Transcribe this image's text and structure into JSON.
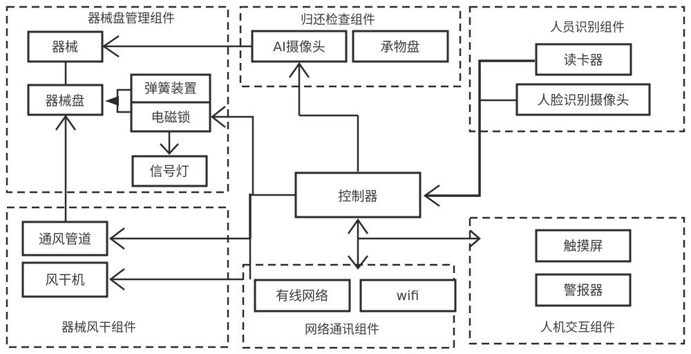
{
  "groups": {
    "tray_management": {
      "label": "器械盘管理组件"
    },
    "return_check": {
      "label": "归还检查组件"
    },
    "personnel_id": {
      "label": "人员识别组件"
    },
    "air_dry": {
      "label": "器械风干组件"
    },
    "network": {
      "label": "网络通讯组件"
    },
    "hmi": {
      "label": "人机交互组件"
    }
  },
  "nodes": {
    "instrument": "器械",
    "instrument_tray": "器械盘",
    "spring_device": "弹簧装置",
    "electromagnetic_lock": "电磁锁",
    "signal_light": "信号灯",
    "ai_camera": "AI摄像头",
    "carrier_tray": "承物盘",
    "card_reader": "读卡器",
    "face_camera": "人脸识别摄像头",
    "controller": "控制器",
    "vent_duct": "通风管道",
    "air_dryer": "风干机",
    "wired_network": "有线网络",
    "wifi": "wifi",
    "touchscreen": "触摸屏",
    "alarm": "警报器"
  },
  "edges": [
    {
      "from": "ai_camera",
      "to": "instrument"
    },
    {
      "from": "controller",
      "to": "ai_camera"
    },
    {
      "from": "controller",
      "to": "electromagnetic_lock"
    },
    {
      "from": "spring_device",
      "to": "instrument_tray"
    },
    {
      "from": "electromagnetic_lock",
      "to": "instrument_tray"
    },
    {
      "from": "electromagnetic_lock",
      "to": "signal_light"
    },
    {
      "from": "vent_duct",
      "to": "instrument_tray"
    },
    {
      "from": "controller",
      "to": "vent_duct"
    },
    {
      "from": "controller",
      "to": "air_dryer"
    },
    {
      "from": "card_reader",
      "to": "controller"
    },
    {
      "from": "face_camera",
      "to": "controller"
    },
    {
      "from": "controller",
      "to": "network",
      "bidirectional": true
    },
    {
      "from": "controller",
      "to": "hmi"
    },
    {
      "from": "instrument",
      "to": "instrument_tray",
      "undirected": true
    }
  ]
}
